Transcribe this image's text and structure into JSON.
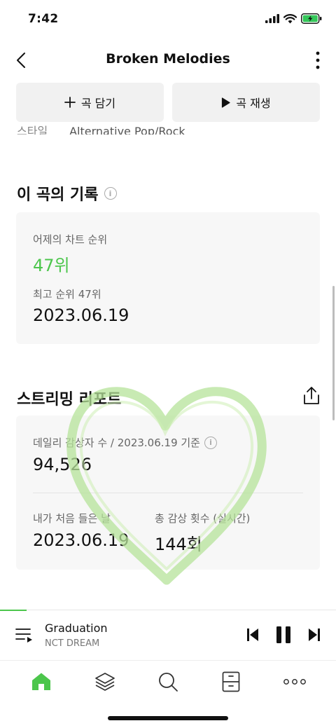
{
  "status": {
    "time": "7:42"
  },
  "nav": {
    "title": "Broken Melodies"
  },
  "actions": {
    "add_label": "곡 담기",
    "play_label": "곡 재생"
  },
  "partial": {
    "key": "스타일",
    "value": "Alternative Pop/Rock"
  },
  "history": {
    "title": "이 곡의 기록",
    "yesterday_label": "어제의 차트 순위",
    "yesterday_value": "47위",
    "best_label": "최고 순위 47위",
    "best_date": "2023.06.19"
  },
  "streaming": {
    "title": "스트리밍 리포트",
    "daily_label": "데일리 감상자 수 / 2023.06.19 기준",
    "daily_value": "94,526",
    "first_label": "내가 처음 들은 날",
    "first_value": "2023.06.19",
    "total_label": "총 감상 횟수 (실시간)",
    "total_value": "144회"
  },
  "player": {
    "title": "Graduation",
    "artist": "NCT DREAM",
    "progress": 0.08
  },
  "colors": {
    "accent": "#4cc64c",
    "heart": "#b6e39a"
  },
  "tabs": [
    "home-icon",
    "layers-icon",
    "search-icon",
    "drawer-icon",
    "more-icon"
  ]
}
